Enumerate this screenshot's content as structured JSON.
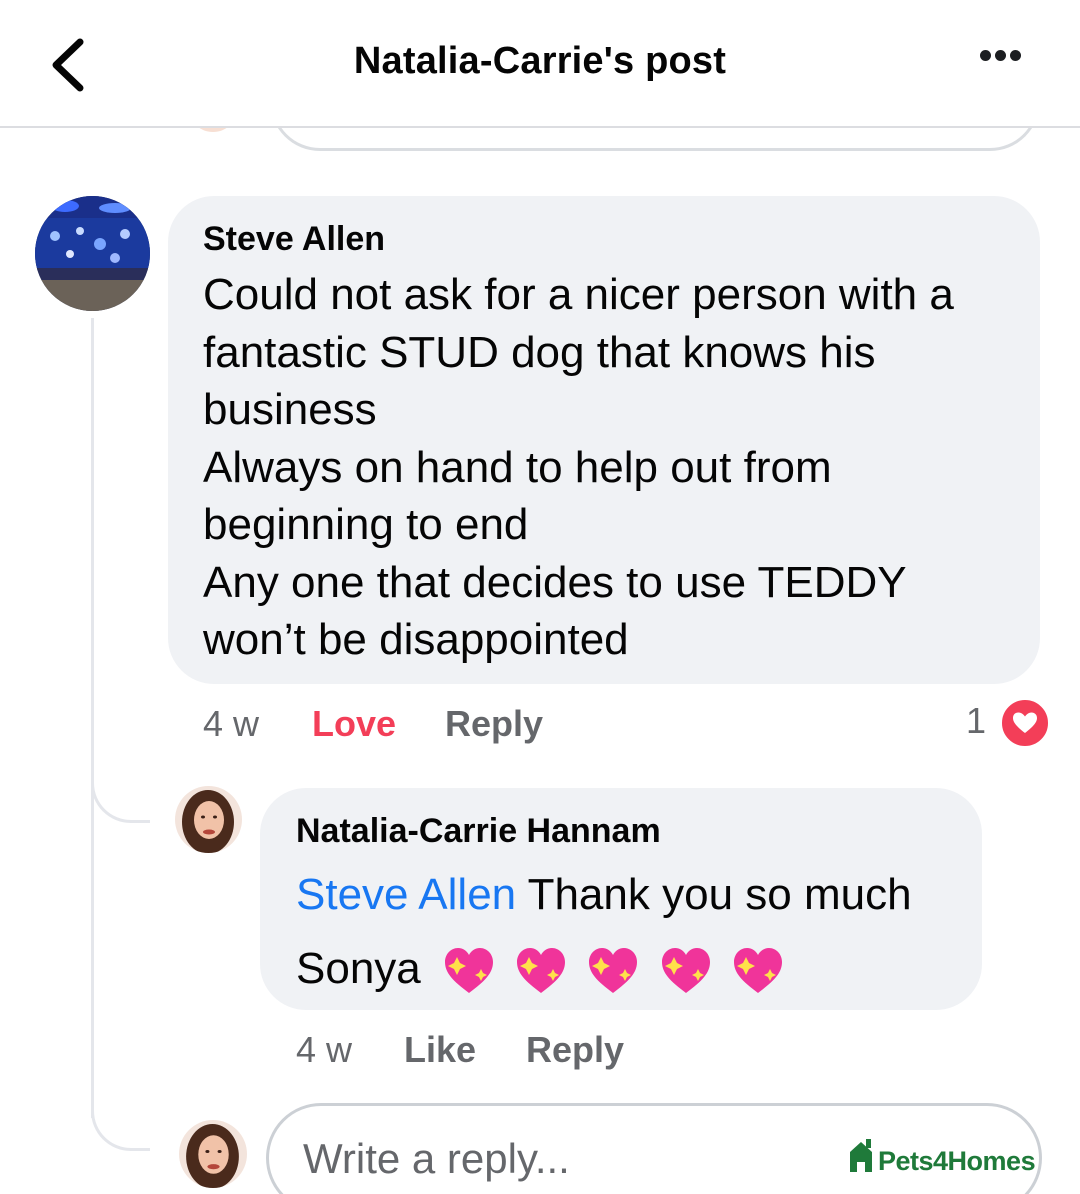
{
  "header": {
    "title": "Natalia-Carrie's post"
  },
  "comment": {
    "author": "Steve Allen",
    "lines": [
      "Could not ask for a nicer person with a",
      "fantastic  STUD dog that knows his",
      "business",
      "Always on hand to help out from",
      "beginning to end",
      "Any one that decides to use TEDDY",
      "won’t be disappointed"
    ],
    "time": "4 w",
    "love_label": "Love",
    "reply_label": "Reply",
    "reaction_count": "1",
    "reaction_icon": "heart-reaction-icon"
  },
  "reply": {
    "author": "Natalia-Carrie Hannam",
    "mention": "Steve Allen",
    "text_after_mention": " Thank you so much",
    "second_line": "Sonya",
    "emoji_count": 5,
    "emoji_icon": "sparkling-heart-icon",
    "time": "4 w",
    "like_label": "Like",
    "reply_label": "Reply"
  },
  "reply_input": {
    "placeholder": "Write a reply..."
  },
  "watermark": {
    "text": "Pets4Homes"
  },
  "colors": {
    "bubble": "#f0f2f5",
    "mention": "#1877f2",
    "love": "#f33e58",
    "meta": "#65676b",
    "watermark": "#1f7a3a"
  }
}
